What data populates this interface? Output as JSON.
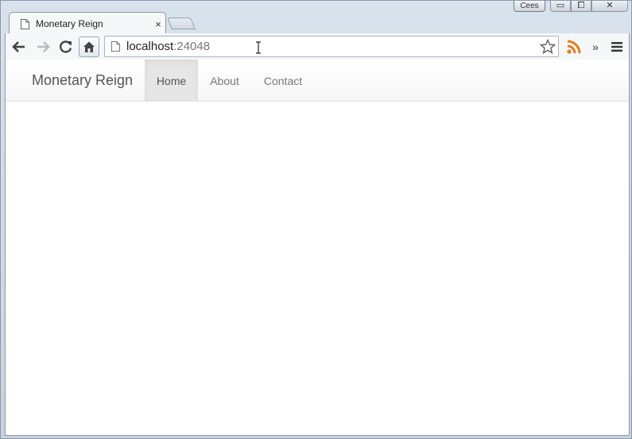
{
  "window": {
    "user_label": "Cees",
    "controls": {
      "minimize": "▭",
      "maximize": "⧠",
      "close": "✕"
    }
  },
  "tab": {
    "title": "Monetary Reign",
    "close": "×"
  },
  "address_bar": {
    "host": "localhost",
    "port": ":24048"
  },
  "toolbar": {
    "overflow": "»"
  },
  "site": {
    "brand": "Monetary Reign",
    "nav": [
      {
        "label": "Home",
        "active": true
      },
      {
        "label": "About",
        "active": false
      },
      {
        "label": "Contact",
        "active": false
      }
    ]
  },
  "colors": {
    "rss": "#e07c21",
    "active_nav_bg": "#e6e6e6"
  },
  "icons": [
    "back-icon",
    "forward-icon",
    "reload-icon",
    "home-icon",
    "page-icon",
    "star-icon",
    "rss-icon",
    "menu-icon",
    "text-cursor-icon"
  ]
}
